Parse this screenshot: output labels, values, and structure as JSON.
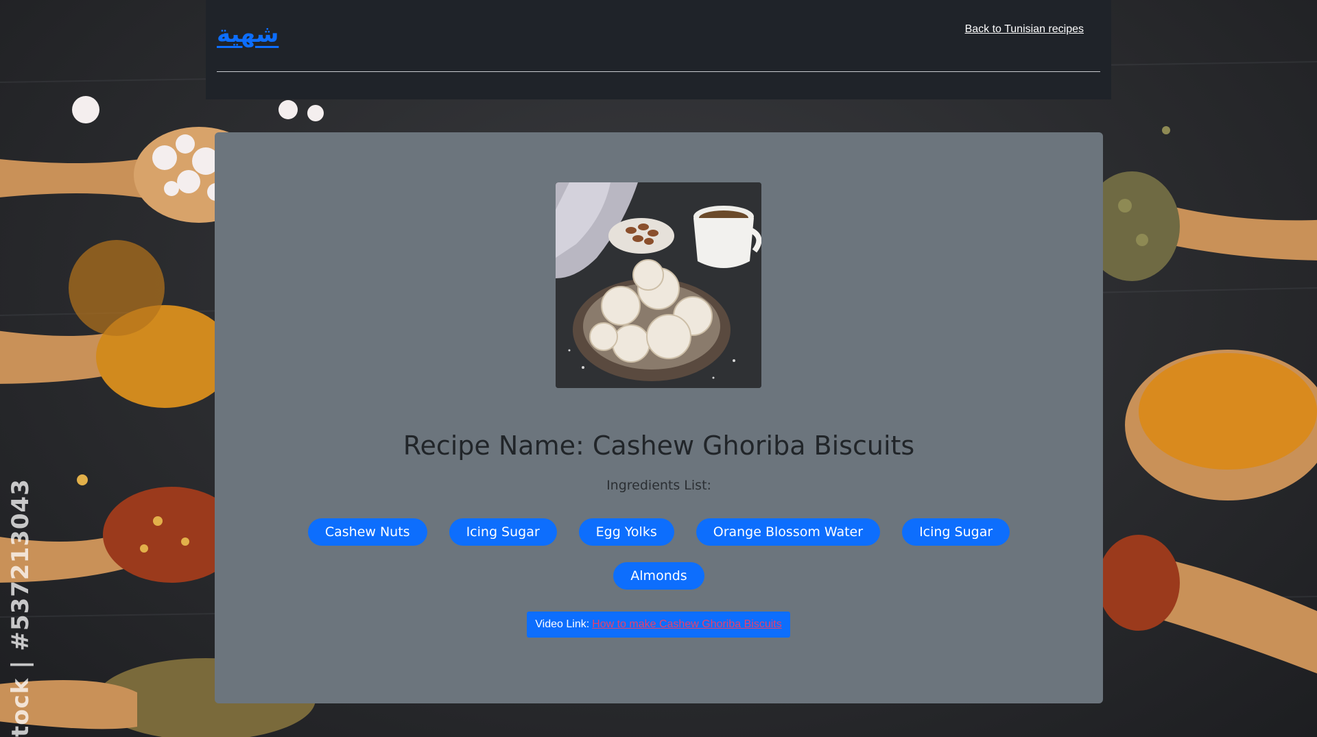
{
  "header": {
    "brand": "شهية",
    "back_link": "Back to Tunisian recipes"
  },
  "background": {
    "watermark": "tock | #537213043"
  },
  "recipe": {
    "image_alt": "Cashew Ghoriba Biscuits",
    "title": "Recipe Name: Cashew Ghoriba Biscuits",
    "ingredients_label": "Ingredients List:",
    "ingredients": [
      "Cashew Nuts",
      "Icing Sugar",
      "Egg Yolks",
      "Orange Blossom Water",
      "Icing Sugar",
      "Almonds"
    ],
    "video_label": "Video Link:",
    "video_link_text": "How to make Cashew Ghoriba Biscuits"
  },
  "colors": {
    "header_bg": "#1f2329",
    "card_bg": "#6c757d",
    "accent": "#0d6efd",
    "link": "#e8406a"
  }
}
